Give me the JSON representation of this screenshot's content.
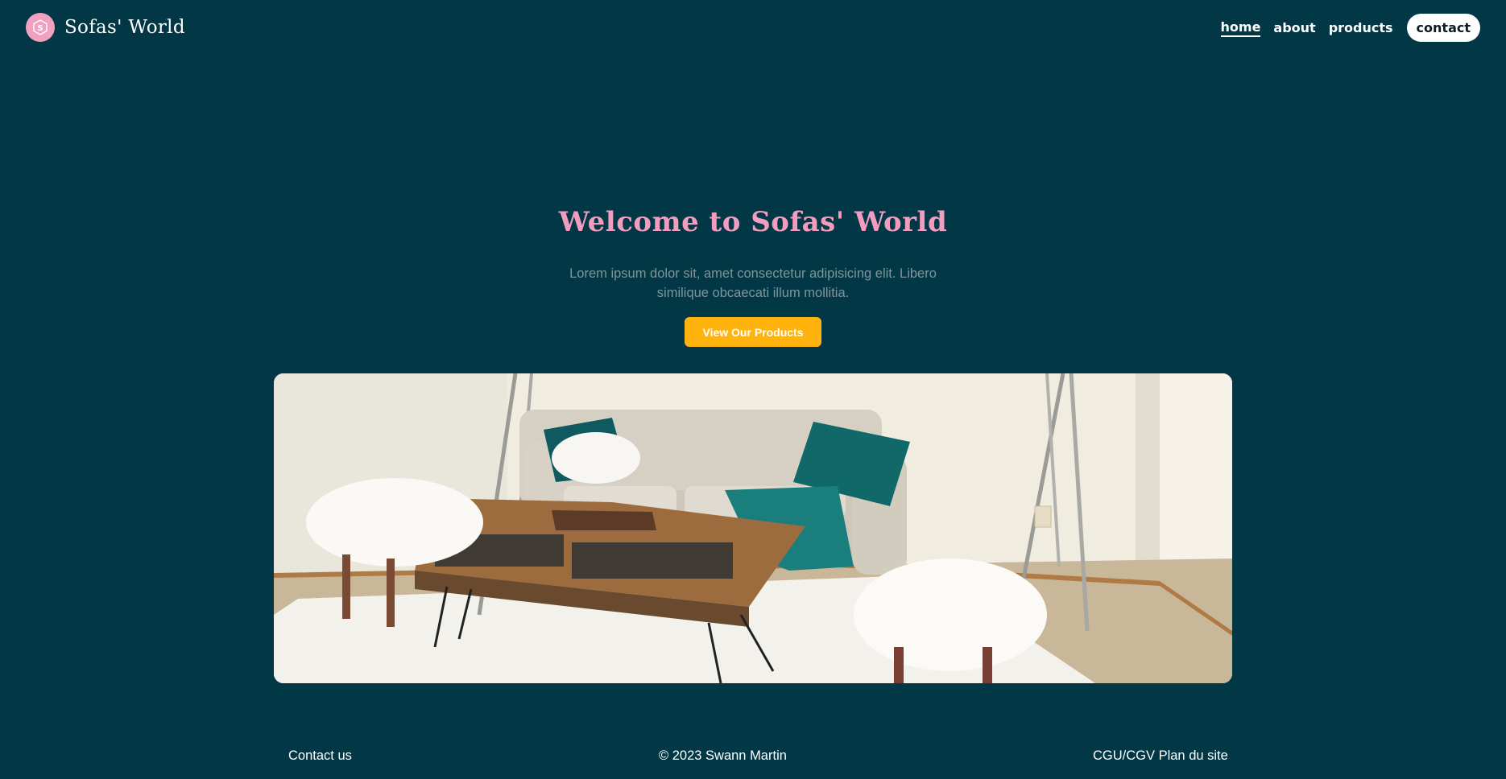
{
  "brand": {
    "name": "Sofas' World",
    "logo_icon": "s-logo-icon",
    "logo_color": "#f2a0c0"
  },
  "nav": {
    "home": "home",
    "about": "about",
    "products": "products",
    "contact": "contact"
  },
  "hero": {
    "title": "Welcome to Sofas' World",
    "subtitle": "Lorem ipsum dolor sit, amet consectetur adipisicing elit. Libero similique obcaecati illum mollitia.",
    "button_label": "View Our Products",
    "image_name": "living-room-sofa-image"
  },
  "footer": {
    "contact": "Contact us",
    "copyright": "© 2023 Swann Martin",
    "legal": "CGU/CGV Plan du site"
  },
  "colors": {
    "background": "#023845",
    "title_pink": "#f29dbf",
    "button_yellow": "#ffb30f",
    "subtitle_gray": "#7f959c"
  }
}
